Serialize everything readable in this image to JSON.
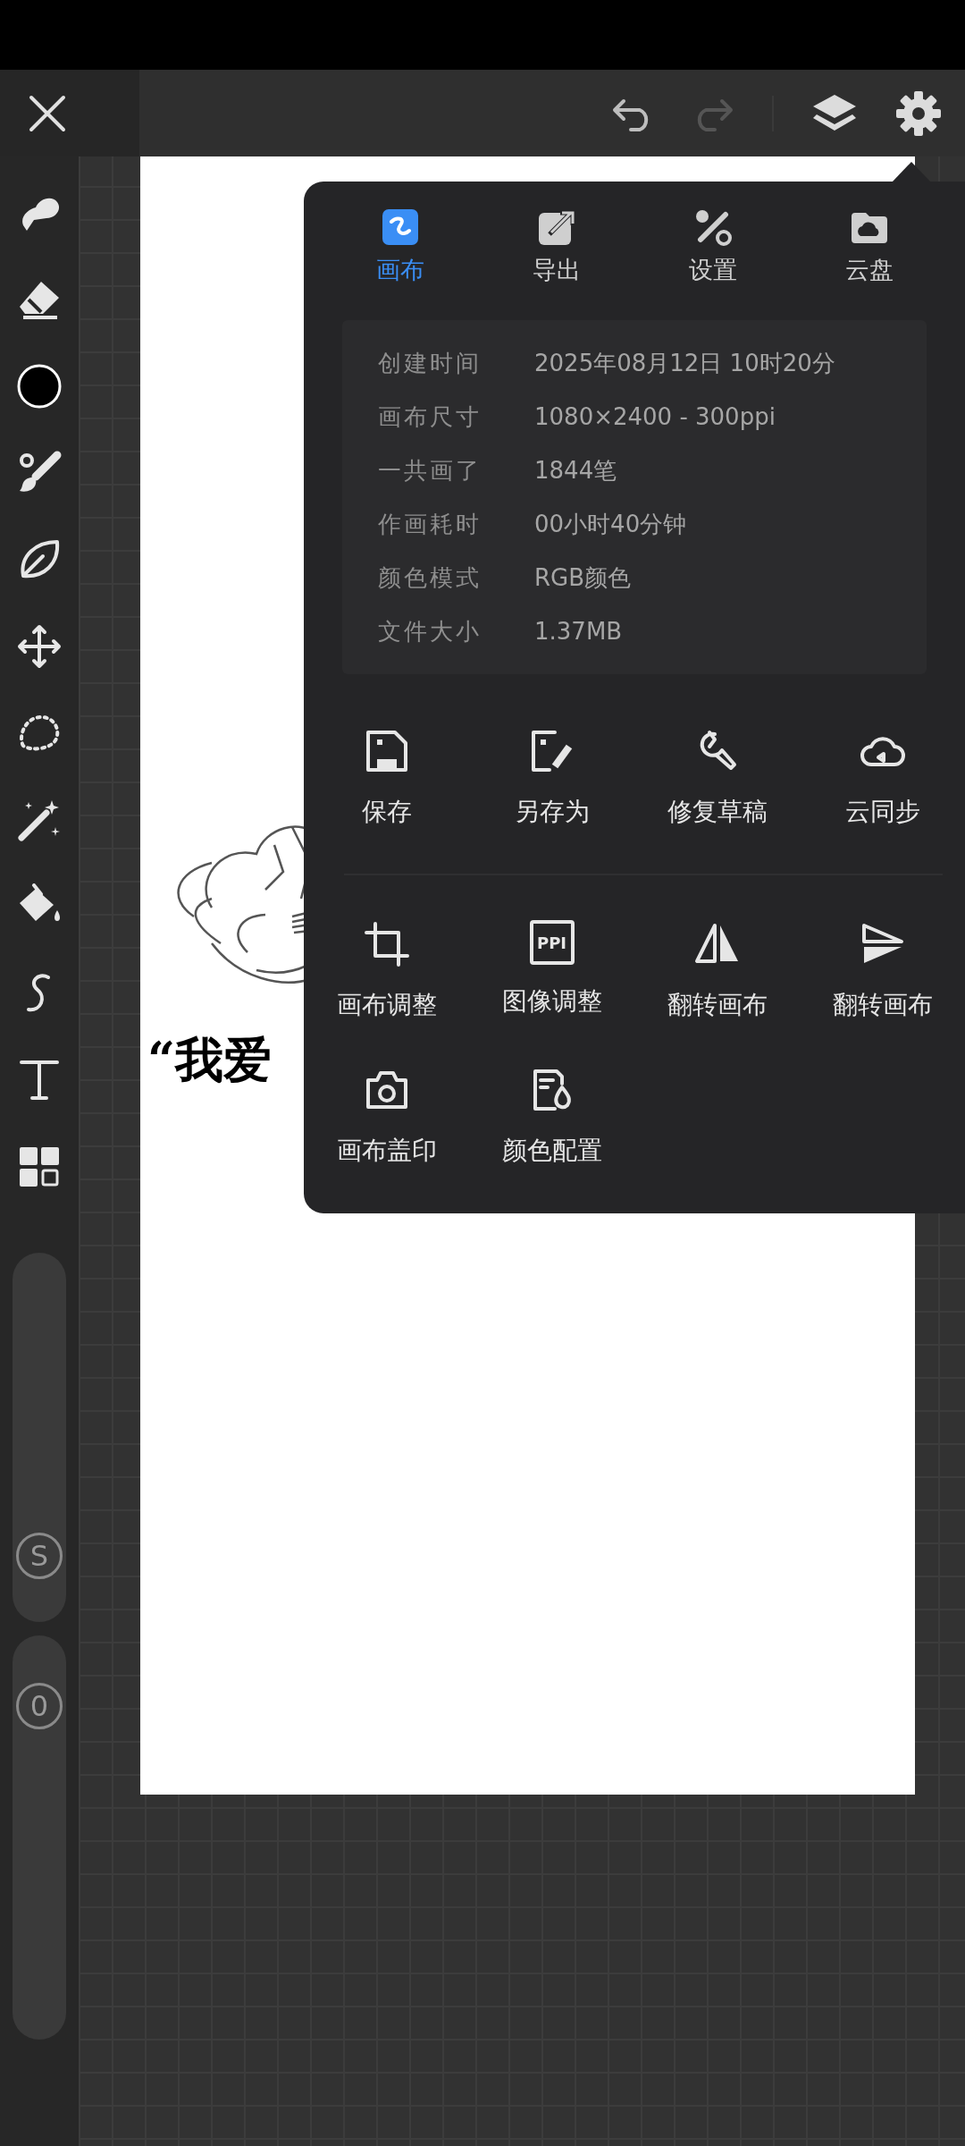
{
  "sliders": [
    {
      "kind": "size",
      "badge": "S",
      "level": 0.12
    },
    {
      "kind": "opacity",
      "badge": "0",
      "level": 0.88
    }
  ],
  "canvas": {
    "artwork_text": "“我爱"
  },
  "popup": {
    "tabs": [
      {
        "label": "画布",
        "selected": true
      },
      {
        "label": "导出",
        "selected": false
      },
      {
        "label": "设置",
        "selected": false
      },
      {
        "label": "云盘",
        "selected": false
      }
    ],
    "info": [
      {
        "label": "创建时间",
        "value": "2025年08月12日 10时20分"
      },
      {
        "label": "画布尺寸",
        "value": "1080×2400 - 300ppi"
      },
      {
        "label": "一共画了",
        "value": "1844笔"
      },
      {
        "label": "作画耗时",
        "value": "00小时40分钟"
      },
      {
        "label": "颜色模式",
        "value": "RGB颜色"
      },
      {
        "label": "文件大小",
        "value": "1.37MB"
      }
    ],
    "action_groups": [
      [
        {
          "label": "保存"
        },
        {
          "label": "另存为"
        },
        {
          "label": "修复草稿"
        },
        {
          "label": "云同步"
        }
      ],
      [
        {
          "label": "画布调整"
        },
        {
          "label": "图像调整",
          "icon_text": "PPI"
        },
        {
          "label": "翻转画布"
        },
        {
          "label": "翻转画布"
        },
        {
          "label": "画布盖印"
        },
        {
          "label": "颜色配置"
        }
      ]
    ]
  }
}
